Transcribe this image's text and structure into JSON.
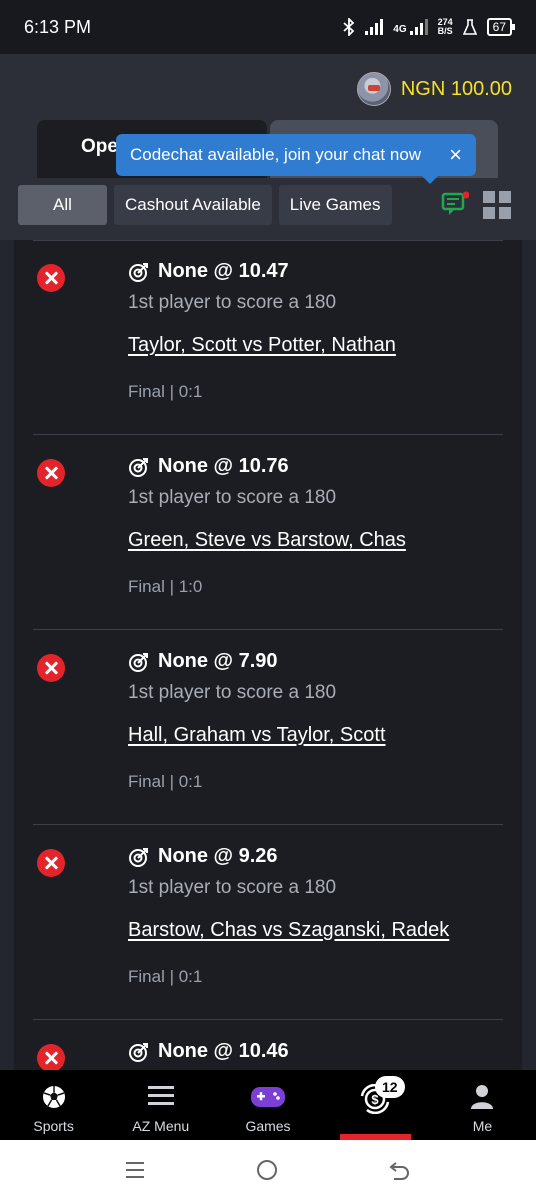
{
  "status_bar": {
    "time": "6:13 PM",
    "network": "4G",
    "net_speed_value": "274",
    "net_speed_unit": "B/S",
    "battery": "67",
    "icons": [
      "bluetooth-icon",
      "signal-icon",
      "signal-4g-icon",
      "net-speed-icon",
      "flask-icon",
      "battery-icon"
    ]
  },
  "header": {
    "balance": "NGN 100.00",
    "tabs": {
      "open_label": "Ope"
    },
    "tooltip": {
      "text": "Codechat available, join your chat now",
      "close": "×"
    }
  },
  "filters": [
    "All",
    "Cashout Available",
    "Live Games"
  ],
  "bets": [
    {
      "selection": "None @ 10.47",
      "market": "1st player to score a 180",
      "event": "Taylor, Scott vs Potter, Nathan",
      "result": "Final  | 0:1"
    },
    {
      "selection": "None @ 10.76",
      "market": "1st player to score a 180",
      "event": "Green, Steve vs Barstow, Chas",
      "result": "Final  | 1:0"
    },
    {
      "selection": "None @ 7.90",
      "market": "1st player to score a 180",
      "event": "Hall, Graham vs Taylor, Scott",
      "result": "Final  | 0:1"
    },
    {
      "selection": "None @ 9.26",
      "market": "1st player to score a 180",
      "event": "Barstow, Chas vs Szaganski, Radek",
      "result": "Final  | 0:1"
    },
    {
      "selection": "None @ 10.46",
      "market": "",
      "event": "",
      "result": ""
    }
  ],
  "bottom_nav": [
    {
      "label": "Sports",
      "icon": "soccer-ball-icon"
    },
    {
      "label": "AZ Menu",
      "icon": "hamburger-icon"
    },
    {
      "label": "Games",
      "icon": "gamepad-icon"
    },
    {
      "label": "",
      "icon": "open-bets-icon",
      "badge": "12",
      "active": true
    },
    {
      "label": "Me",
      "icon": "person-icon"
    }
  ],
  "colors": {
    "accent_yellow": "#f5e02a",
    "lost_red": "#e3242b",
    "tooltip_blue": "#2f7cd1",
    "chat_green": "#1fa84f"
  }
}
